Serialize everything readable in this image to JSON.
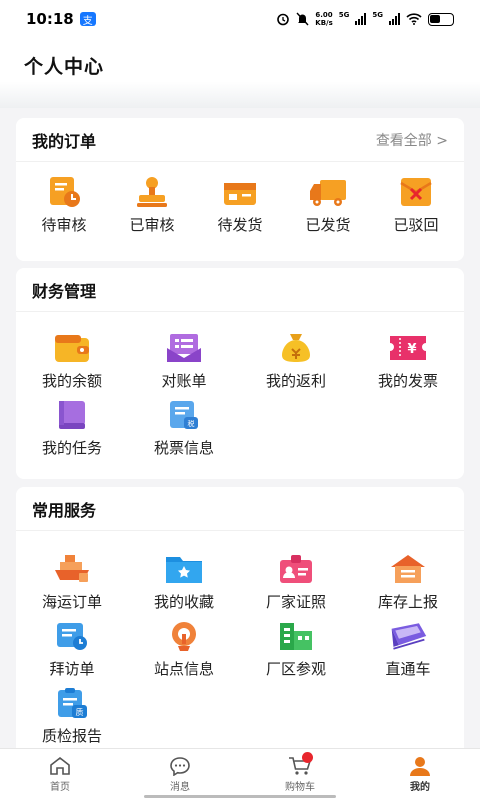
{
  "status_bar": {
    "time": "10:18",
    "app_badge": "支",
    "net_speed_value": "6.00",
    "net_speed_unit": "KB/s",
    "sim1": "5G",
    "sim2": "5G"
  },
  "header": {
    "title": "个人中心"
  },
  "orders": {
    "title": "我的订单",
    "more": "查看全部 >",
    "items": [
      {
        "label": "待审核",
        "icon": "pending-review-icon"
      },
      {
        "label": "已审核",
        "icon": "approved-stamp-icon"
      },
      {
        "label": "待发货",
        "icon": "to-ship-icon"
      },
      {
        "label": "已发货",
        "icon": "shipped-truck-icon"
      },
      {
        "label": "已驳回",
        "icon": "rejected-icon"
      }
    ]
  },
  "finance": {
    "title": "财务管理",
    "items": [
      {
        "label": "我的余额",
        "icon": "wallet-icon"
      },
      {
        "label": "对账单",
        "icon": "statement-icon"
      },
      {
        "label": "我的返利",
        "icon": "money-bag-icon"
      },
      {
        "label": "我的发票",
        "icon": "invoice-icon"
      },
      {
        "label": "我的任务",
        "icon": "task-book-icon"
      },
      {
        "label": "税票信息",
        "icon": "tax-receipt-icon"
      }
    ]
  },
  "services": {
    "title": "常用服务",
    "items": [
      {
        "label": "海运订单",
        "icon": "ship-icon"
      },
      {
        "label": "我的收藏",
        "icon": "favorite-folder-icon"
      },
      {
        "label": "厂家证照",
        "icon": "license-icon"
      },
      {
        "label": "库存上报",
        "icon": "warehouse-icon"
      },
      {
        "label": "拜访单",
        "icon": "visit-form-icon"
      },
      {
        "label": "站点信息",
        "icon": "location-icon"
      },
      {
        "label": "厂区参观",
        "icon": "factory-icon"
      },
      {
        "label": "直通车",
        "icon": "train-icon"
      },
      {
        "label": "质检报告",
        "icon": "quality-report-icon",
        "icon_text": "质"
      }
    ]
  },
  "tabbar": [
    {
      "label": "首页",
      "icon": "home-icon"
    },
    {
      "label": "消息",
      "icon": "message-icon"
    },
    {
      "label": "购物车",
      "icon": "cart-icon"
    },
    {
      "label": "我的",
      "icon": "profile-icon"
    }
  ],
  "colors": {
    "orange": "#f08a1c",
    "accent_red": "#e8262d",
    "purple": "#8a5ad8",
    "blue": "#3a8de0",
    "green": "#2aa84a"
  }
}
